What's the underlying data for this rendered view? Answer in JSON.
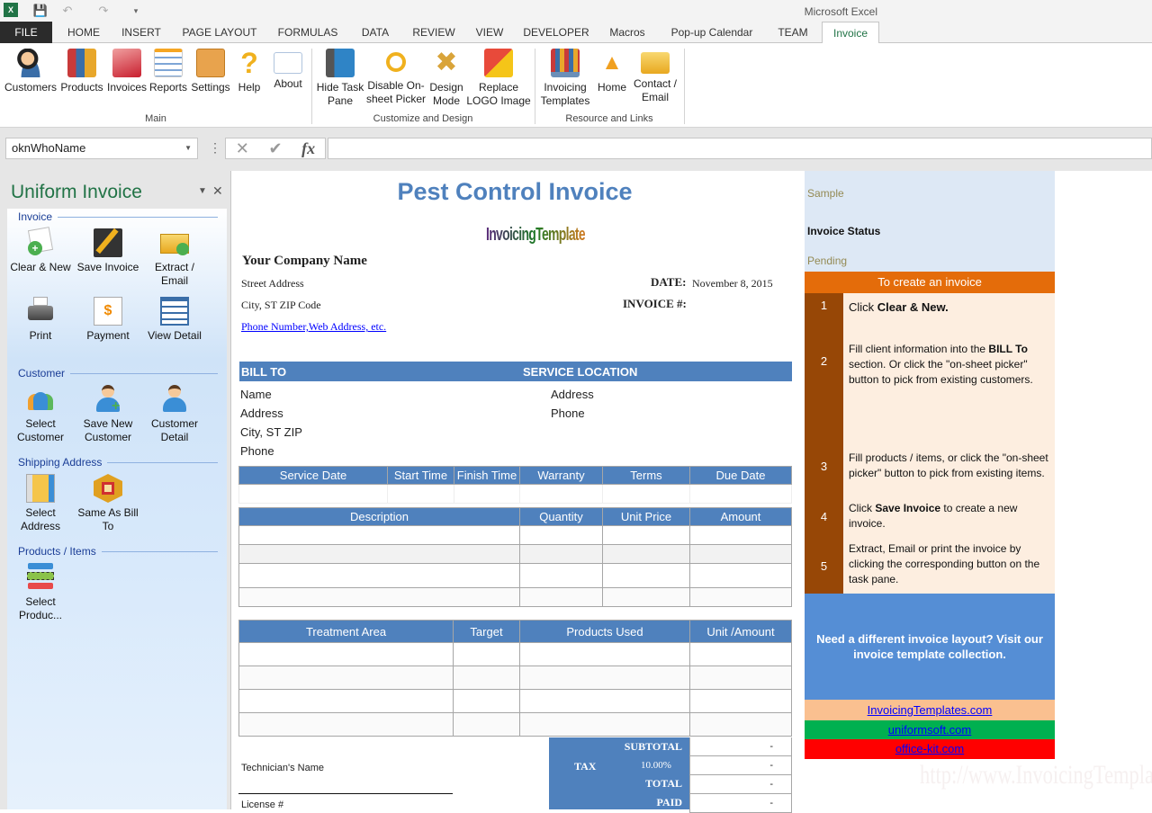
{
  "app": {
    "title": "Microsoft Excel"
  },
  "quick_access": [
    {
      "icon": "excel-logo-icon"
    },
    {
      "icon": "save-icon"
    },
    {
      "icon": "undo-icon"
    },
    {
      "icon": "redo-icon"
    },
    {
      "icon": "customize-qat-icon"
    }
  ],
  "tabs": [
    {
      "label": "FILE"
    },
    {
      "label": "HOME"
    },
    {
      "label": "INSERT"
    },
    {
      "label": "PAGE LAYOUT"
    },
    {
      "label": "FORMULAS"
    },
    {
      "label": "DATA"
    },
    {
      "label": "REVIEW"
    },
    {
      "label": "VIEW"
    },
    {
      "label": "DEVELOPER"
    },
    {
      "label": "Macros"
    },
    {
      "label": "Pop-up Calendar"
    },
    {
      "label": "TEAM"
    },
    {
      "label": "Invoice"
    }
  ],
  "active_tab": "Invoice",
  "ribbon": {
    "groups": [
      {
        "label": "Main",
        "buttons": [
          {
            "label": "Customers",
            "icon": "customers-icon"
          },
          {
            "label": "Products",
            "icon": "products-icon"
          },
          {
            "label": "Invoices",
            "icon": "invoices-icon"
          },
          {
            "label": "Reports",
            "icon": "reports-icon"
          },
          {
            "label": "Settings",
            "icon": "settings-icon"
          },
          {
            "label": "Help",
            "icon": "help-icon"
          },
          {
            "label": "About",
            "icon": "about-icon"
          }
        ]
      },
      {
        "label": "Customize and Design",
        "buttons": [
          {
            "label": "Hide Task Pane",
            "icon": "hide-task-pane-icon"
          },
          {
            "label": "Disable On-sheet Picker",
            "icon": "magnifier-icon"
          },
          {
            "label": "Design Mode",
            "icon": "design-mode-icon"
          },
          {
            "label": "Replace LOGO Image",
            "icon": "replace-logo-icon"
          }
        ]
      },
      {
        "label": "Resource and Links",
        "buttons": [
          {
            "label": "Invoicing Templates",
            "icon": "templates-icon"
          },
          {
            "label": "Home",
            "icon": "home-icon"
          },
          {
            "label": "Contact / Email",
            "icon": "email-icon"
          }
        ]
      }
    ]
  },
  "formula_bar": {
    "name_box": "oknWhoName",
    "formula": ""
  },
  "task_pane": {
    "title": "Uniform Invoice",
    "sections": [
      {
        "label": "Invoice",
        "buttons": [
          {
            "label": "Clear & New"
          },
          {
            "label": "Save Invoice"
          },
          {
            "label": "Extract / Email"
          },
          {
            "label": "Print"
          },
          {
            "label": "Payment"
          },
          {
            "label": "View Detail"
          }
        ]
      },
      {
        "label": "Customer",
        "buttons": [
          {
            "label": "Select Customer"
          },
          {
            "label": "Save New Customer"
          },
          {
            "label": "Customer Detail"
          }
        ]
      },
      {
        "label": "Shipping Address",
        "buttons": [
          {
            "label": "Select Address"
          },
          {
            "label": "Same As Bill To"
          }
        ]
      },
      {
        "label": "Products / Items",
        "buttons": [
          {
            "label": "Select Produc..."
          }
        ]
      }
    ]
  },
  "invoice": {
    "title": "Pest Control Invoice",
    "logo_text": "InvoicingTemplate",
    "company_name": "Your Company Name",
    "street": "Street Address",
    "city": "City, ST  ZIP Code",
    "contact_link": "Phone Number,Web Address, etc.",
    "date_label": "DATE:",
    "date_value": "November 8, 2015",
    "invoice_no_label": "INVOICE #:",
    "invoice_no_value": "",
    "bill_to_label": "BILL TO",
    "service_location_label": "SERVICE LOCATION",
    "bill_to": [
      "Name",
      "Address",
      "City, ST ZIP",
      "Phone"
    ],
    "service_location": [
      "Address",
      "Phone"
    ],
    "service_table": {
      "headers": [
        "Service Date",
        "Start Time",
        "Finish Time",
        "Warranty",
        "Terms",
        "Due Date"
      ],
      "rows": [
        [
          "",
          "",
          "",
          "",
          "",
          ""
        ]
      ]
    },
    "items_table": {
      "headers": [
        "Description",
        "Quantity",
        "Unit Price",
        "Amount"
      ],
      "rows": [
        [
          "",
          "",
          "",
          ""
        ],
        [
          "",
          "",
          "",
          ""
        ],
        [
          "",
          "",
          "",
          ""
        ],
        [
          "",
          "",
          "",
          ""
        ]
      ]
    },
    "treatment_table": {
      "headers": [
        "Treatment Area",
        "Target",
        "Products Used",
        "Unit /Amount"
      ],
      "rows": [
        [
          "",
          "",
          "",
          ""
        ],
        [
          "",
          "",
          "",
          ""
        ],
        [
          "",
          "",
          "",
          ""
        ],
        [
          "",
          "",
          "",
          ""
        ]
      ]
    },
    "technician_label": "Technician's Name",
    "license_label": "License #",
    "totals": {
      "subtotal_label": "SUBTOTAL",
      "subtotal": "-",
      "tax_label": "TAX",
      "tax_rate": "10.00%",
      "tax": "-",
      "total_label": "TOTAL",
      "total": "-",
      "paid_label": "PAID",
      "paid": "-"
    }
  },
  "side_panel": {
    "sample": "Sample",
    "status_label": "Invoice Status",
    "status_value": "Pending",
    "steps_header": "To create an invoice",
    "steps": [
      {
        "num": "1",
        "pre": "Click ",
        "bold": "Clear & New.",
        "post": ""
      },
      {
        "num": "2",
        "pre": "Fill client information into the ",
        "bold": "BILL To",
        "post": " section. Or click the \"on-sheet picker\" button to pick from existing customers."
      },
      {
        "num": "3",
        "pre": "Fill products / items, or click the \"on-sheet picker\" button to pick from existing items.",
        "bold": "",
        "post": ""
      },
      {
        "num": "4",
        "pre": "Click ",
        "bold": "Save Invoice",
        "post": " to create a new invoice."
      },
      {
        "num": "5",
        "pre": "Extract, Email or print the invoice by clicking the corresponding button on the task pane.",
        "bold": "",
        "post": ""
      }
    ],
    "promo": "Need a different invoice layout? Visit our invoice template collection.",
    "links": [
      {
        "label": "InvoicingTemplates.com ",
        "bg": "#fac090"
      },
      {
        "label": "uniformsoft.com ",
        "bg": "#00b050"
      },
      {
        "label": "office-kit.com ",
        "bg": "#ff0000"
      }
    ],
    "watermark": "http://www.InvoicingTemplate.com"
  },
  "colors": {
    "accent": "#4f81bd",
    "excel_green": "#217346",
    "orange": "#e46c0a",
    "brown": "#974706"
  }
}
